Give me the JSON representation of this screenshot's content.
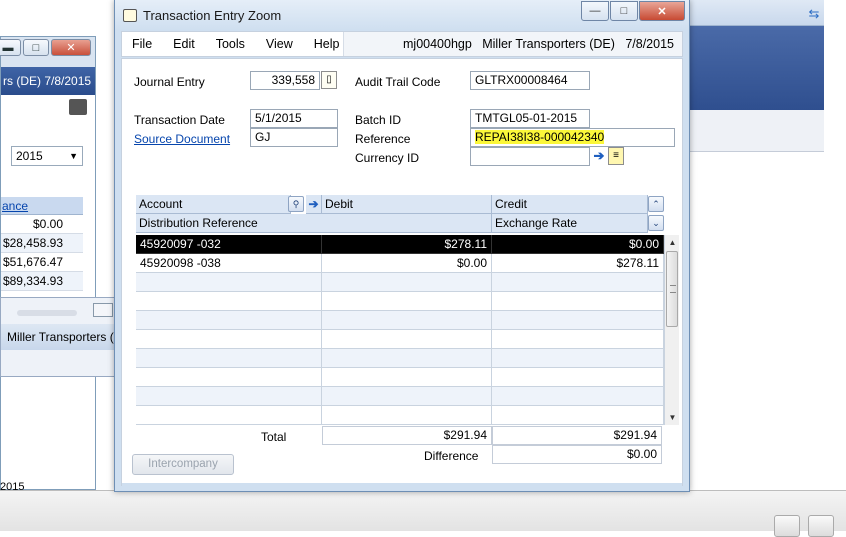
{
  "window": {
    "title": "Transaction Entry Zoom",
    "controls": {
      "minimize": "—",
      "maximize": "□",
      "close": "✕"
    }
  },
  "menu": {
    "items": [
      "File",
      "Edit",
      "Tools",
      "View",
      "Help"
    ],
    "user_info": "mj00400hgp",
    "company": "Miller Transporters (DE)",
    "date": "7/8/2015"
  },
  "form": {
    "journal_entry": {
      "label": "Journal Entry",
      "value": "339,558"
    },
    "audit_trail_code": {
      "label": "Audit Trail Code",
      "value": "GLTRX00008464"
    },
    "transaction_date": {
      "label": "Transaction Date",
      "value": "5/1/2015"
    },
    "batch_id": {
      "label": "Batch ID",
      "value": "TMTGL05-01-2015"
    },
    "source_document": {
      "label": "Source Document",
      "value": "GJ"
    },
    "reference": {
      "label": "Reference",
      "value": "REPAI38I38-000042340"
    },
    "currency_id": {
      "label": "Currency ID",
      "value": ""
    }
  },
  "grid": {
    "headers": {
      "account": "Account",
      "debit": "Debit",
      "credit": "Credit",
      "distribution_reference": "Distribution Reference",
      "exchange_rate": "Exchange Rate"
    },
    "rows": [
      {
        "account": "45920097 -032",
        "debit": "$278.11",
        "credit": "$0.00",
        "selected": true
      },
      {
        "account": "45920098 -038",
        "debit": "$0.00",
        "credit": "$278.11",
        "selected": false
      }
    ],
    "empty_rows": 8
  },
  "totals": {
    "total_label": "Total",
    "total_debit": "$291.94",
    "total_credit": "$291.94",
    "difference_label": "Difference",
    "difference_value": "$0.00"
  },
  "buttons": {
    "intercompany": "Intercompany"
  },
  "background": {
    "left_window": {
      "header": "rs (DE)  7/8/2015",
      "year": "2015",
      "grid_header": "ance",
      "values": [
        "$0.00",
        "$28,458.93",
        "$51,676.47",
        "$89,334.93"
      ],
      "bottom_text": "2015"
    },
    "mid_window": {
      "company": "Miller Transporters ("
    }
  },
  "colors": {
    "selection": "#000000",
    "highlight": "#fbf73a",
    "link": "#0645ad",
    "window_frame": "#cfdff0"
  }
}
